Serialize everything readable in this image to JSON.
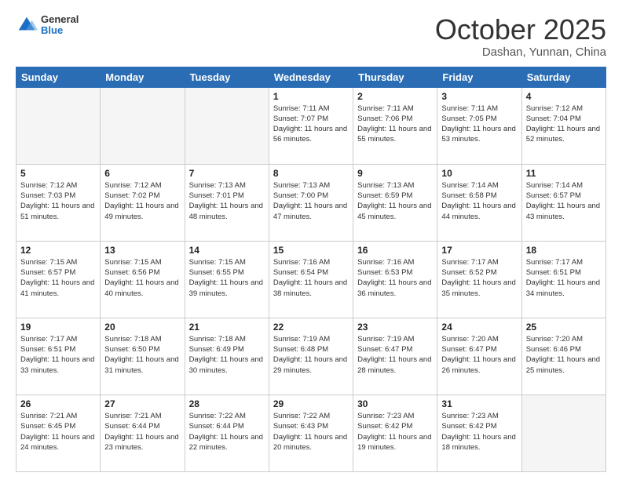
{
  "header": {
    "logo_general": "General",
    "logo_blue": "Blue",
    "month": "October 2025",
    "location": "Dashan, Yunnan, China"
  },
  "weekdays": [
    "Sunday",
    "Monday",
    "Tuesday",
    "Wednesday",
    "Thursday",
    "Friday",
    "Saturday"
  ],
  "weeks": [
    [
      {
        "day": "",
        "sunrise": "",
        "sunset": "",
        "daylight": ""
      },
      {
        "day": "",
        "sunrise": "",
        "sunset": "",
        "daylight": ""
      },
      {
        "day": "",
        "sunrise": "",
        "sunset": "",
        "daylight": ""
      },
      {
        "day": "1",
        "sunrise": "Sunrise: 7:11 AM",
        "sunset": "Sunset: 7:07 PM",
        "daylight": "Daylight: 11 hours and 56 minutes."
      },
      {
        "day": "2",
        "sunrise": "Sunrise: 7:11 AM",
        "sunset": "Sunset: 7:06 PM",
        "daylight": "Daylight: 11 hours and 55 minutes."
      },
      {
        "day": "3",
        "sunrise": "Sunrise: 7:11 AM",
        "sunset": "Sunset: 7:05 PM",
        "daylight": "Daylight: 11 hours and 53 minutes."
      },
      {
        "day": "4",
        "sunrise": "Sunrise: 7:12 AM",
        "sunset": "Sunset: 7:04 PM",
        "daylight": "Daylight: 11 hours and 52 minutes."
      }
    ],
    [
      {
        "day": "5",
        "sunrise": "Sunrise: 7:12 AM",
        "sunset": "Sunset: 7:03 PM",
        "daylight": "Daylight: 11 hours and 51 minutes."
      },
      {
        "day": "6",
        "sunrise": "Sunrise: 7:12 AM",
        "sunset": "Sunset: 7:02 PM",
        "daylight": "Daylight: 11 hours and 49 minutes."
      },
      {
        "day": "7",
        "sunrise": "Sunrise: 7:13 AM",
        "sunset": "Sunset: 7:01 PM",
        "daylight": "Daylight: 11 hours and 48 minutes."
      },
      {
        "day": "8",
        "sunrise": "Sunrise: 7:13 AM",
        "sunset": "Sunset: 7:00 PM",
        "daylight": "Daylight: 11 hours and 47 minutes."
      },
      {
        "day": "9",
        "sunrise": "Sunrise: 7:13 AM",
        "sunset": "Sunset: 6:59 PM",
        "daylight": "Daylight: 11 hours and 45 minutes."
      },
      {
        "day": "10",
        "sunrise": "Sunrise: 7:14 AM",
        "sunset": "Sunset: 6:58 PM",
        "daylight": "Daylight: 11 hours and 44 minutes."
      },
      {
        "day": "11",
        "sunrise": "Sunrise: 7:14 AM",
        "sunset": "Sunset: 6:57 PM",
        "daylight": "Daylight: 11 hours and 43 minutes."
      }
    ],
    [
      {
        "day": "12",
        "sunrise": "Sunrise: 7:15 AM",
        "sunset": "Sunset: 6:57 PM",
        "daylight": "Daylight: 11 hours and 41 minutes."
      },
      {
        "day": "13",
        "sunrise": "Sunrise: 7:15 AM",
        "sunset": "Sunset: 6:56 PM",
        "daylight": "Daylight: 11 hours and 40 minutes."
      },
      {
        "day": "14",
        "sunrise": "Sunrise: 7:15 AM",
        "sunset": "Sunset: 6:55 PM",
        "daylight": "Daylight: 11 hours and 39 minutes."
      },
      {
        "day": "15",
        "sunrise": "Sunrise: 7:16 AM",
        "sunset": "Sunset: 6:54 PM",
        "daylight": "Daylight: 11 hours and 38 minutes."
      },
      {
        "day": "16",
        "sunrise": "Sunrise: 7:16 AM",
        "sunset": "Sunset: 6:53 PM",
        "daylight": "Daylight: 11 hours and 36 minutes."
      },
      {
        "day": "17",
        "sunrise": "Sunrise: 7:17 AM",
        "sunset": "Sunset: 6:52 PM",
        "daylight": "Daylight: 11 hours and 35 minutes."
      },
      {
        "day": "18",
        "sunrise": "Sunrise: 7:17 AM",
        "sunset": "Sunset: 6:51 PM",
        "daylight": "Daylight: 11 hours and 34 minutes."
      }
    ],
    [
      {
        "day": "19",
        "sunrise": "Sunrise: 7:17 AM",
        "sunset": "Sunset: 6:51 PM",
        "daylight": "Daylight: 11 hours and 33 minutes."
      },
      {
        "day": "20",
        "sunrise": "Sunrise: 7:18 AM",
        "sunset": "Sunset: 6:50 PM",
        "daylight": "Daylight: 11 hours and 31 minutes."
      },
      {
        "day": "21",
        "sunrise": "Sunrise: 7:18 AM",
        "sunset": "Sunset: 6:49 PM",
        "daylight": "Daylight: 11 hours and 30 minutes."
      },
      {
        "day": "22",
        "sunrise": "Sunrise: 7:19 AM",
        "sunset": "Sunset: 6:48 PM",
        "daylight": "Daylight: 11 hours and 29 minutes."
      },
      {
        "day": "23",
        "sunrise": "Sunrise: 7:19 AM",
        "sunset": "Sunset: 6:47 PM",
        "daylight": "Daylight: 11 hours and 28 minutes."
      },
      {
        "day": "24",
        "sunrise": "Sunrise: 7:20 AM",
        "sunset": "Sunset: 6:47 PM",
        "daylight": "Daylight: 11 hours and 26 minutes."
      },
      {
        "day": "25",
        "sunrise": "Sunrise: 7:20 AM",
        "sunset": "Sunset: 6:46 PM",
        "daylight": "Daylight: 11 hours and 25 minutes."
      }
    ],
    [
      {
        "day": "26",
        "sunrise": "Sunrise: 7:21 AM",
        "sunset": "Sunset: 6:45 PM",
        "daylight": "Daylight: 11 hours and 24 minutes."
      },
      {
        "day": "27",
        "sunrise": "Sunrise: 7:21 AM",
        "sunset": "Sunset: 6:44 PM",
        "daylight": "Daylight: 11 hours and 23 minutes."
      },
      {
        "day": "28",
        "sunrise": "Sunrise: 7:22 AM",
        "sunset": "Sunset: 6:44 PM",
        "daylight": "Daylight: 11 hours and 22 minutes."
      },
      {
        "day": "29",
        "sunrise": "Sunrise: 7:22 AM",
        "sunset": "Sunset: 6:43 PM",
        "daylight": "Daylight: 11 hours and 20 minutes."
      },
      {
        "day": "30",
        "sunrise": "Sunrise: 7:23 AM",
        "sunset": "Sunset: 6:42 PM",
        "daylight": "Daylight: 11 hours and 19 minutes."
      },
      {
        "day": "31",
        "sunrise": "Sunrise: 7:23 AM",
        "sunset": "Sunset: 6:42 PM",
        "daylight": "Daylight: 11 hours and 18 minutes."
      },
      {
        "day": "",
        "sunrise": "",
        "sunset": "",
        "daylight": ""
      }
    ]
  ]
}
